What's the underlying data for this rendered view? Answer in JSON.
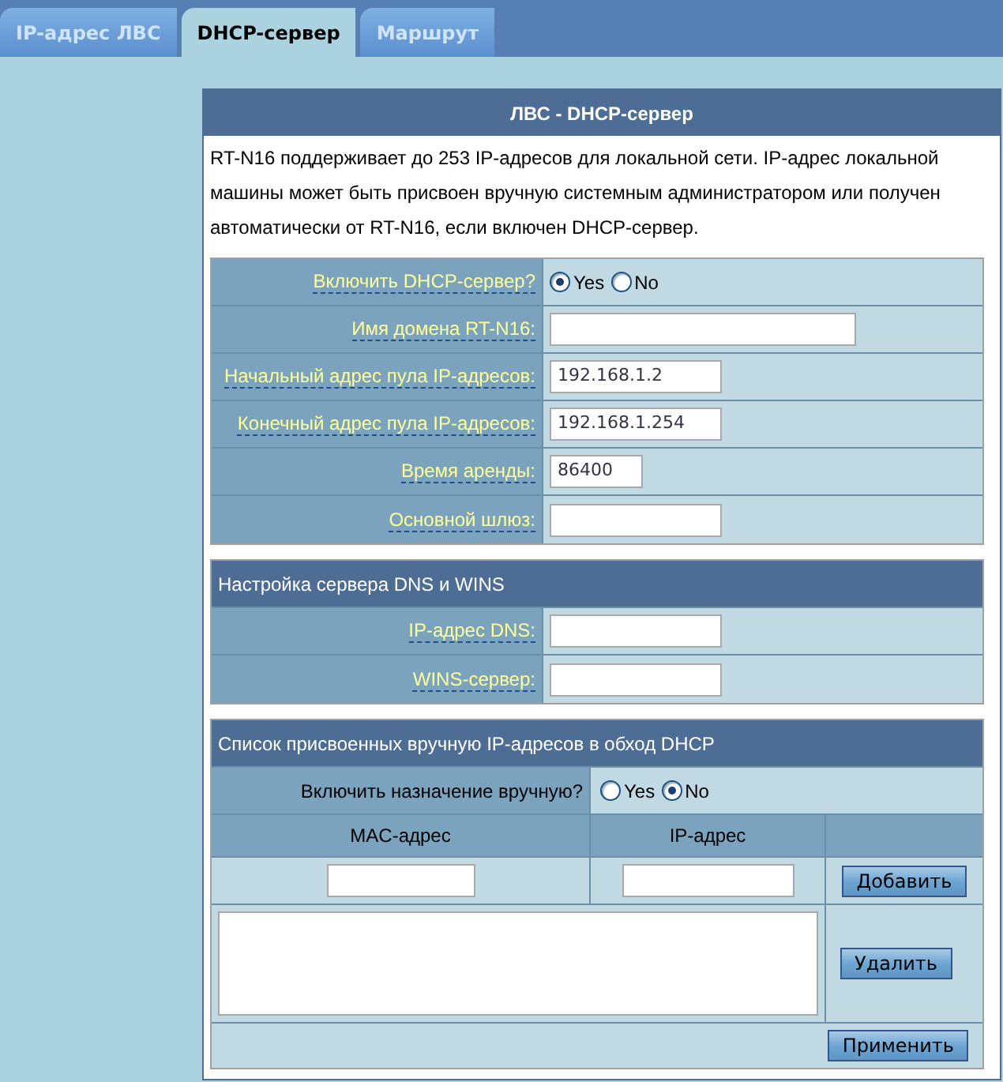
{
  "tabs": [
    {
      "label": "IP-адрес ЛВС",
      "selected": false
    },
    {
      "label": "DHCP-сервер",
      "selected": true
    },
    {
      "label": "Маршрут",
      "selected": false
    }
  ],
  "panel": {
    "title": "ЛВС - DHCP-сервер",
    "description": "RT-N16 поддерживает до 253 IP-адресов для локальной сети. IP-адрес локальной машины может быть присвоен вручную системным администратором или получен автоматически от RT-N16, если включен DHCP-сервер."
  },
  "dhcp_rows": [
    {
      "kind": "radio",
      "label": "Включить DHCP-сервер?",
      "options": [
        {
          "label": "Yes",
          "selected": true
        },
        {
          "label": "No",
          "selected": false
        }
      ]
    },
    {
      "kind": "widefield",
      "label": "Имя домена RT-N16:"
    },
    {
      "kind": "field",
      "label": "Начальный адрес пула IP-адресов:",
      "value": "192.168.1.2"
    },
    {
      "kind": "field",
      "label": "Конечный адрес пула IP-адресов:",
      "value": "192.168.1.254"
    },
    {
      "kind": "shortfield",
      "label": "Время аренды:",
      "value": "86400"
    },
    {
      "kind": "field",
      "label": "Основной шлюз:"
    }
  ],
  "dns_section": {
    "title": "Настройка сервера DNS и WINS",
    "rows": [
      {
        "kind": "field",
        "label": "IP-адрес DNS:"
      },
      {
        "kind": "field",
        "label": "WINS-сервер:"
      }
    ]
  },
  "manual_section": {
    "title": "Список присвоенных вручную IP-адресов в обход DHCP",
    "enable_label": "Включить назначение вручную?",
    "enable_options": [
      {
        "label": "Yes",
        "selected": false
      },
      {
        "label": "No",
        "selected": true
      }
    ],
    "columns": [
      "MAC-адрес",
      "IP-адрес"
    ],
    "add_button": "Добавить",
    "delete_button": "Удалить",
    "apply_button": "Применить"
  }
}
